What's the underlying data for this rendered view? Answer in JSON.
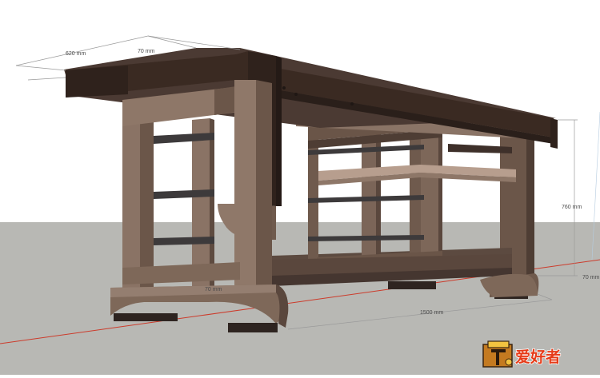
{
  "viewport": {
    "sky_color": "#ffffff",
    "ground_color": "#b8b8b4",
    "axis_color": "#cc3b2b"
  },
  "dimensions": {
    "depth": "620 mm",
    "top_thickness": "70 mm",
    "height": "760 mm",
    "length": "1500 mm",
    "foot_height": "70 mm",
    "small_left": "70 mm"
  },
  "model": {
    "wood_color": "#7a6558",
    "top_color": "#3a2a22",
    "shelf_color": "#b79e8e"
  },
  "logo": {
    "text": "爱好者"
  }
}
